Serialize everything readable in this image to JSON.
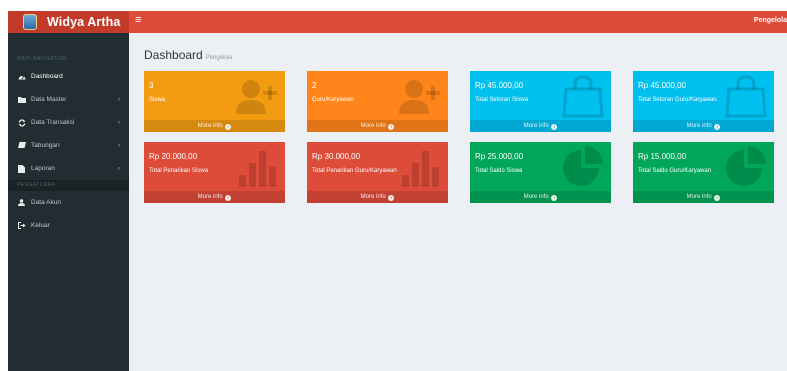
{
  "brand": {
    "name": "Widya Artha"
  },
  "header": {
    "menu_glyph": "≡",
    "user_label": "Pengelola"
  },
  "sidebar": {
    "section_main": "MAIN NAVIGATION",
    "section_settings": "PENGATURAN",
    "items": [
      {
        "label": "Dashboard",
        "icon": "dashboard-icon",
        "has_caret": false
      },
      {
        "label": "Data Master",
        "icon": "folder-icon",
        "has_caret": true
      },
      {
        "label": "Data Transaksi",
        "icon": "refresh-icon",
        "has_caret": true
      },
      {
        "label": "Tabungan",
        "icon": "book-icon",
        "has_caret": true
      },
      {
        "label": "Laporan",
        "icon": "file-icon",
        "has_caret": true
      }
    ],
    "settings_items": [
      {
        "label": "Data Akun",
        "icon": "user-icon"
      },
      {
        "label": "Keluar",
        "icon": "sign-out-icon"
      }
    ],
    "caret_glyph": "‹"
  },
  "page": {
    "title": "Dashboard",
    "subtitle": "Pengelola"
  },
  "boxes": [
    {
      "value": "3",
      "label": "Siswa",
      "more": "More info",
      "color": "#f39c12",
      "icon": "user-plus-icon"
    },
    {
      "value": "2",
      "label": "Guru/Karyawan",
      "more": "More info",
      "color": "#ff851b",
      "icon": "user-plus-icon"
    },
    {
      "value": "Rp 45.000,00",
      "label": "Total Setoran Siswa",
      "more": "More info",
      "color": "#00c0ef",
      "icon": "shopping-bag-icon"
    },
    {
      "value": "Rp 45.000,00",
      "label": "Total Setoran Guru/Karyawan",
      "more": "More info",
      "color": "#00c0ef",
      "icon": "shopping-bag-icon"
    },
    {
      "value": "Rp 20.000,00",
      "label": "Total Penarikan Siswa",
      "more": "More info",
      "color": "#dd4b39",
      "icon": "bar-chart-icon"
    },
    {
      "value": "Rp 30.000,00",
      "label": "Total Penarikan Guru/Karyawan",
      "more": "More info",
      "color": "#dd4b39",
      "icon": "bar-chart-icon"
    },
    {
      "value": "Rp 25.000,00",
      "label": "Total Saldo Siswa",
      "more": "More info",
      "color": "#00a65a",
      "icon": "pie-chart-icon"
    },
    {
      "value": "Rp 15.000,00",
      "label": "Total Saldo Guru/Karyawan",
      "more": "More info",
      "color": "#00a65a",
      "icon": "pie-chart-icon"
    }
  ]
}
